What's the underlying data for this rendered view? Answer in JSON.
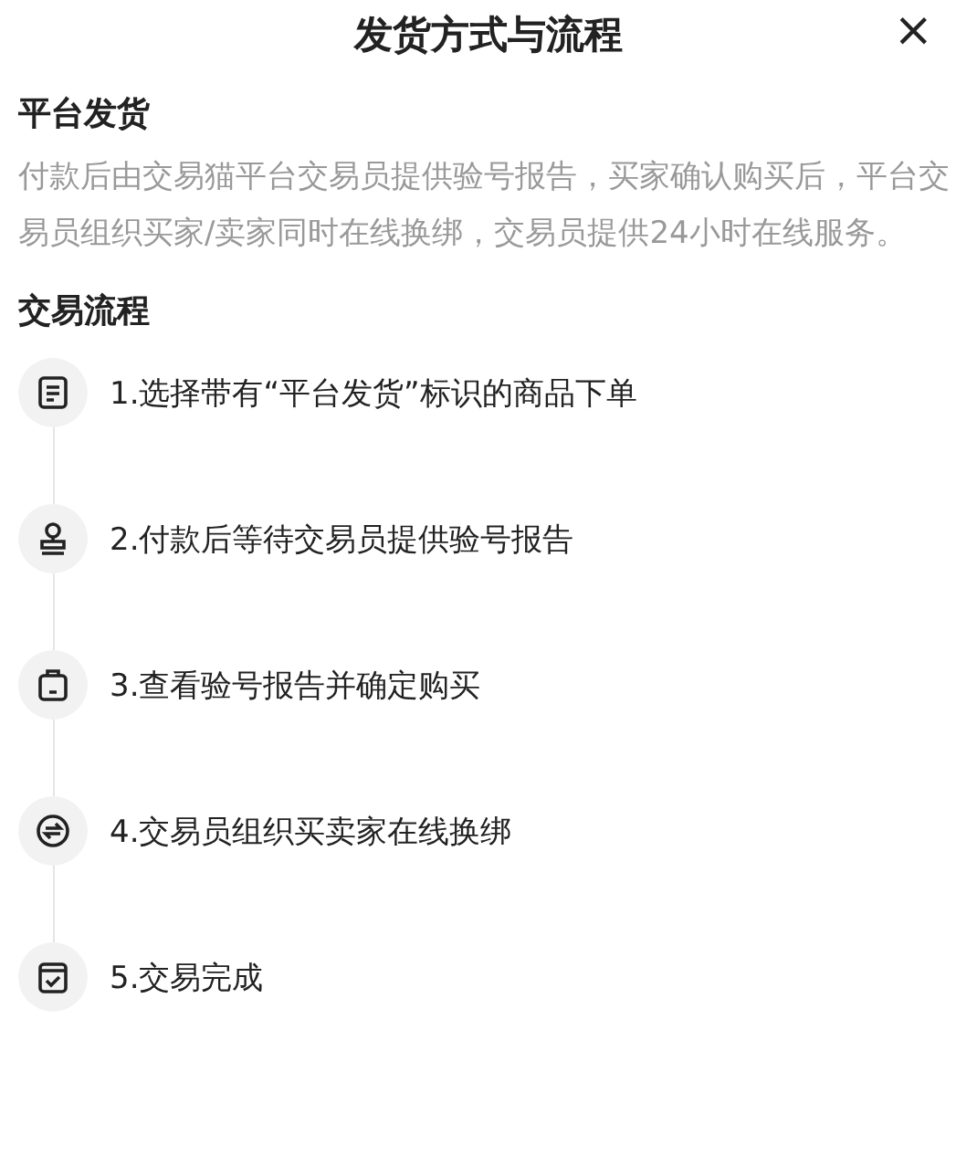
{
  "title": "发货方式与流程",
  "close": "×",
  "section": {
    "heading": "平台发货",
    "text": "付款后由交易猫平台交易员提供验号报告，买家确认购买后，平台交易员组织买家/卖家同时在线换绑，交易员提供24小时在线服务。"
  },
  "process": {
    "heading": "交易流程",
    "steps": [
      {
        "kind": "document",
        "label": "1.选择带有“平台发货”标识的商品下单"
      },
      {
        "kind": "stamp",
        "label": "2.付款后等待交易员提供验号报告"
      },
      {
        "kind": "bag",
        "label": "3.查看验号报告并确定购买"
      },
      {
        "kind": "exchange",
        "label": "4.交易员组织买卖家在线换绑"
      },
      {
        "kind": "check",
        "label": "5.交易完成"
      }
    ]
  }
}
